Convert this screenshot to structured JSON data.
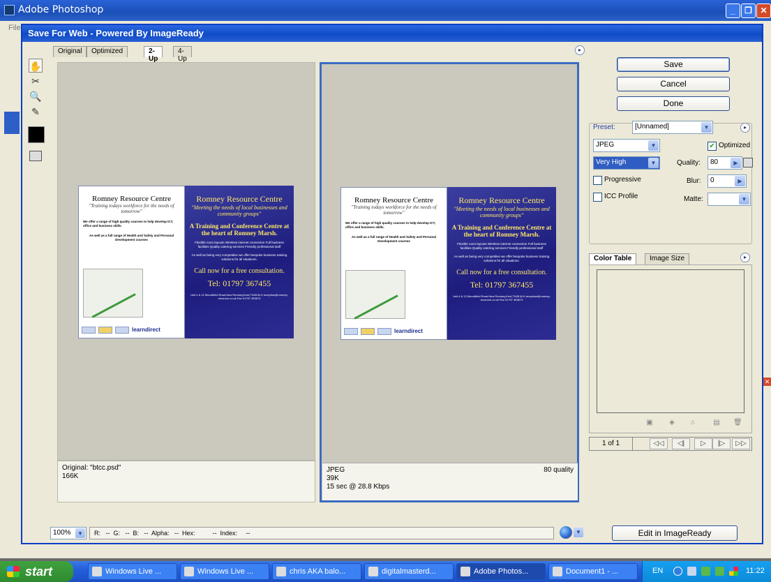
{
  "ps_window": {
    "title": "Adobe Photoshop",
    "menu_file": "File"
  },
  "dialog": {
    "title": "Save For Web - Powered By ImageReady",
    "tabs": [
      "Original",
      "Optimized",
      "2-Up",
      "4-Up"
    ],
    "active_tab": "2-Up"
  },
  "panes": {
    "original": {
      "line1": "Original: \"btcc.psd\"",
      "line2": "166K"
    },
    "optimized": {
      "format": "JPEG",
      "quality": "80 quality",
      "size": "39K",
      "time": "15 sec @ 28.8 Kbps"
    }
  },
  "flyer": {
    "left_title": "Romney Resource Centre",
    "left_tagline": "\"Training todays workforce for the needs of tomorrow\"",
    "left_text1": "We offer a range of high quality courses to help develop ICT, office and business skills.",
    "left_text2": "As well as a full range of Health and Safety and Personal Development courses",
    "logo_text": "learndirect",
    "right_title": "Romney Resource Centre",
    "right_tagline": "\"Meeting the needs of local businesses and community groups\"",
    "right_heading": "A Training and Conference Centre at the heart of Romney Marsh.",
    "right_features": "Flexible room layouts   Wireless internet connection   Full business facilities   Quality catering services   Friendly professional staff",
    "right_offer": "As well as being very competitive we offer bespoke business training solutions for all situations.",
    "right_call": "Call now for a free consultation.",
    "right_tel": "Tel: 01797 367455",
    "right_address": "Unit 4 & 12 Mountfield Road,New Romney,Kent,TN28 8LH  reception@romney-resource.co.uk   Fax 01797 363673"
  },
  "right_panel": {
    "save": "Save",
    "cancel": "Cancel",
    "done": "Done",
    "preset_label": "Preset:",
    "preset_value": "[Unnamed]",
    "format_value": "JPEG",
    "optimized_label": "Optimized",
    "quality_preset_value": "Very High",
    "quality_label": "Quality:",
    "quality_value": "80",
    "progressive_label": "Progressive",
    "blur_label": "Blur:",
    "blur_value": "0",
    "icc_label": "ICC Profile",
    "matte_label": "Matte:",
    "color_table_tab": "Color Table",
    "image_size_tab": "Image Size",
    "frame_count": "1 of 1",
    "edit_in_imageready": "Edit in ImageReady"
  },
  "status_bar": {
    "zoom": "100%",
    "pixel_info": "R:   --  G:   --  B:   --  Alpha:   --  Hex:          --  Index:     --"
  },
  "taskbar": {
    "start": "start",
    "tasks": [
      "Windows Live ...",
      "Windows Live ...",
      "chris AKA balo...",
      "digitalmasterd...",
      "Adobe Photos...",
      "Document1 - ..."
    ],
    "language": "EN",
    "clock": "11:22"
  }
}
